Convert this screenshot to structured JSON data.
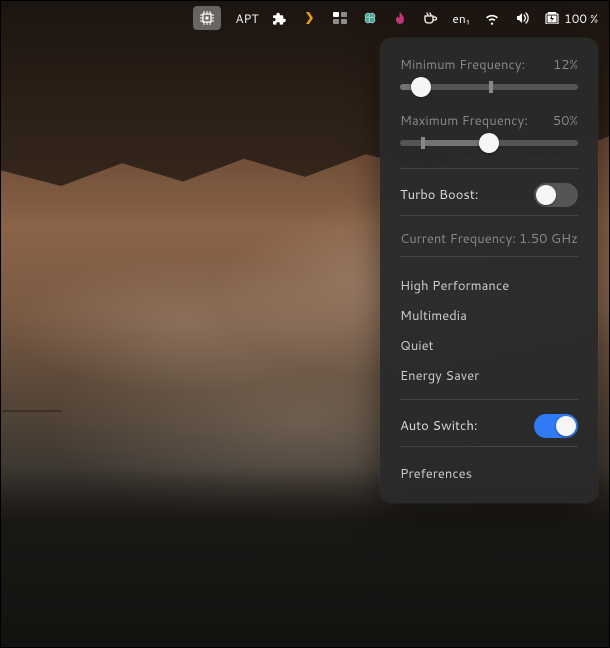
{
  "menubar": {
    "apt_label": "APT",
    "lang_label": "en₁",
    "battery_text": "100 %"
  },
  "panel": {
    "min_freq": {
      "label": "Minimum Frequency:",
      "value": "12%",
      "percent": 12,
      "tick": 50
    },
    "max_freq": {
      "label": "Maximum Frequency:",
      "value": "50%",
      "percent": 50,
      "tick": 12
    },
    "turbo": {
      "label": "Turbo Boost:",
      "on": false
    },
    "current": {
      "label": "Current Frequency:",
      "value": "1.50 GHz"
    },
    "profiles": [
      "High Performance",
      "Multimedia",
      "Quiet",
      "Energy Saver"
    ],
    "auto_switch": {
      "label": "Auto Switch:",
      "on": true
    },
    "preferences_label": "Preferences"
  }
}
